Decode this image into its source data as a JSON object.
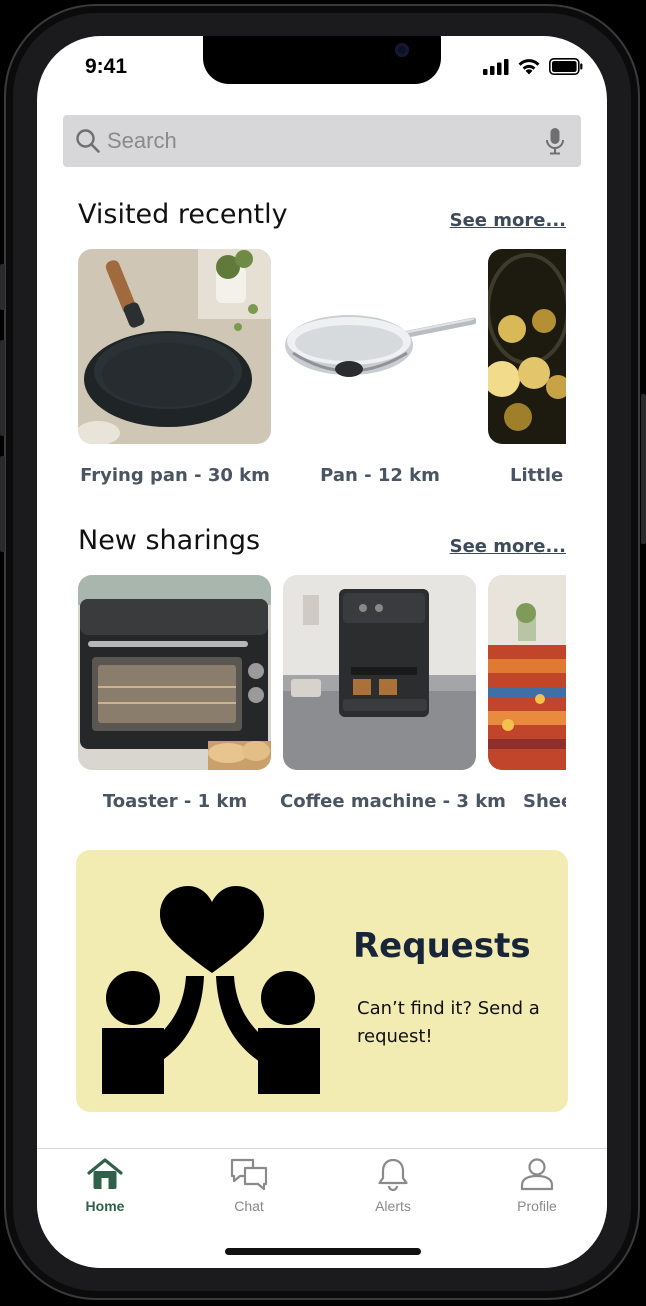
{
  "status_bar": {
    "time": "9:41"
  },
  "search": {
    "placeholder": "Search"
  },
  "visited": {
    "title": "Visited recently",
    "see_more": "See more...",
    "items": [
      {
        "label": "Frying pan - 30 km"
      },
      {
        "label": "Pan - 12 km"
      },
      {
        "label": "Little li"
      }
    ]
  },
  "sharings": {
    "title": "New sharings",
    "see_more": "See more...",
    "items": [
      {
        "label": "Toaster - 1 km"
      },
      {
        "label": "Coffee machine - 3 km"
      },
      {
        "label": "Shee"
      }
    ]
  },
  "requests": {
    "title": "Requests",
    "subtitle": "Can’t find it? Send a request!"
  },
  "tabs": [
    {
      "label": "Home",
      "icon": "home-icon",
      "active": true
    },
    {
      "label": "Chat",
      "icon": "chat-icon",
      "active": false
    },
    {
      "label": "Alerts",
      "icon": "bell-icon",
      "active": false
    },
    {
      "label": "Profile",
      "icon": "user-icon",
      "active": false
    }
  ],
  "colors": {
    "accent": "#2f6049",
    "banner": "#f2ecb2",
    "search_bg": "#d7d7d9"
  }
}
